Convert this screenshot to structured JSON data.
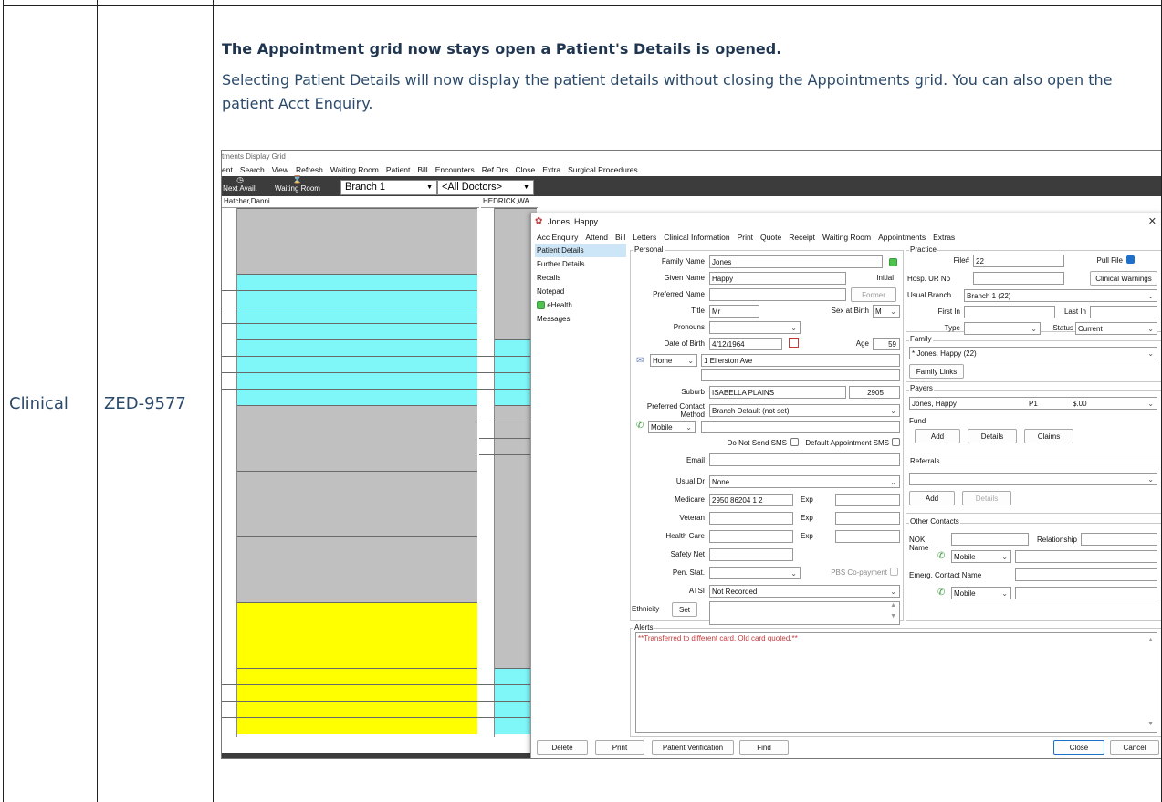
{
  "table": {
    "category": "Clinical",
    "ticket": "ZED-9577",
    "heading": "The Appointment grid now stays open a Patient's Details is opened.",
    "paragraph": "Selecting Patient Details will now display the patient details without closing the Appointments grid. You can also open the patient Acct Enquiry."
  },
  "app": {
    "window_title": "tments Display Grid",
    "menu": [
      "ent",
      "Search",
      "View",
      "Refresh",
      "Waiting Room",
      "Patient",
      "Bill",
      "Encounters",
      "Ref Drs",
      "Close",
      "Extra",
      "Surgical Procedures"
    ],
    "toolbar": {
      "next_avail": "Next Avail.",
      "waiting_room": "Waiting Room",
      "branch": "Branch 1",
      "doctors": "<All Doctors>"
    },
    "grid": {
      "col1": "Hatcher,Danni",
      "col2": "HEDRICK,WA"
    }
  },
  "dialog": {
    "title": "Jones, Happy",
    "menu": [
      "Acc Enquiry",
      "Attend",
      "Bill",
      "Letters",
      "Clinical Information",
      "Print",
      "Quote",
      "Receipt",
      "Waiting Room",
      "Appointments",
      "Extras"
    ],
    "nav": [
      "Patient Details",
      "Further Details",
      "Recalls",
      "Notepad",
      "eHealth",
      "Messages"
    ],
    "personal": {
      "group": "Personal",
      "family_name_label": "Family Name",
      "family_name": "Jones",
      "given_name_label": "Given Name",
      "given_name": "Happy",
      "initial_label": "Initial",
      "preferred_name_label": "Preferred Name",
      "former": "Former",
      "title_label": "Title",
      "title": "Mr",
      "sex_label": "Sex at Birth",
      "sex": "M",
      "pronouns_label": "Pronouns",
      "dob_label": "Date of Birth",
      "dob": "4/12/1964",
      "age_label": "Age",
      "age": "59",
      "address_type": "Home",
      "address": "1 Ellerston Ave",
      "suburb_label": "Suburb",
      "suburb": "ISABELLA PLAINS",
      "postcode": "2905",
      "contact_method_label": "Preferred Contact Method",
      "contact_method": "Branch Default (not set)",
      "phone_type": "Mobile",
      "do_not_sms": "Do Not Send SMS",
      "default_appt_sms": "Default Appointment SMS",
      "email_label": "Email",
      "usual_dr_label": "Usual Dr",
      "usual_dr": "None",
      "medicare_label": "Medicare",
      "medicare": "2950 86204 1  2",
      "exp_label": "Exp",
      "veteran_label": "Veteran",
      "health_care_label": "Health Care",
      "safety_net_label": "Safety Net",
      "pen_stat_label": "Pen. Stat.",
      "pbs_label": "PBS Co-payment",
      "atsi_label": "ATSI",
      "atsi": "Not Recorded",
      "ethnicity_label": "Ethnicity",
      "set": "Set"
    },
    "practice": {
      "group": "Practice",
      "file_label": "File#",
      "file": "22",
      "pull_file": "Pull File",
      "hosp_label": "Hosp. UR No",
      "clinical_warnings": "Clinical Warnings",
      "usual_branch_label": "Usual Branch",
      "usual_branch": "Branch 1  (22)",
      "first_in_label": "First In",
      "last_in_label": "Last In",
      "type_label": "Type",
      "status_label": "Status",
      "status": "Current"
    },
    "family": {
      "group": "Family",
      "value": "* Jones, Happy (22)",
      "links": "Family Links"
    },
    "payers": {
      "group": "Payers",
      "name": "Jones, Happy",
      "code": "P1",
      "amount": "$.00",
      "fund_label": "Fund",
      "add": "Add",
      "details": "Details",
      "claims": "Claims"
    },
    "referrals": {
      "group": "Referrals",
      "add": "Add",
      "details": "Details"
    },
    "other": {
      "group": "Other Contacts",
      "nok_label": "NOK Name",
      "relationship_label": "Relationship",
      "mobile1": "Mobile",
      "emerg_label": "Emerg. Contact Name",
      "mobile2": "Mobile"
    },
    "alerts": {
      "group": "Alerts",
      "text": "**Transferred to different card, Old card quoted.**"
    },
    "footer": {
      "delete": "Delete",
      "print": "Print",
      "verification": "Patient Verification",
      "find": "Find",
      "close": "Close",
      "cancel": "Cancel"
    }
  }
}
